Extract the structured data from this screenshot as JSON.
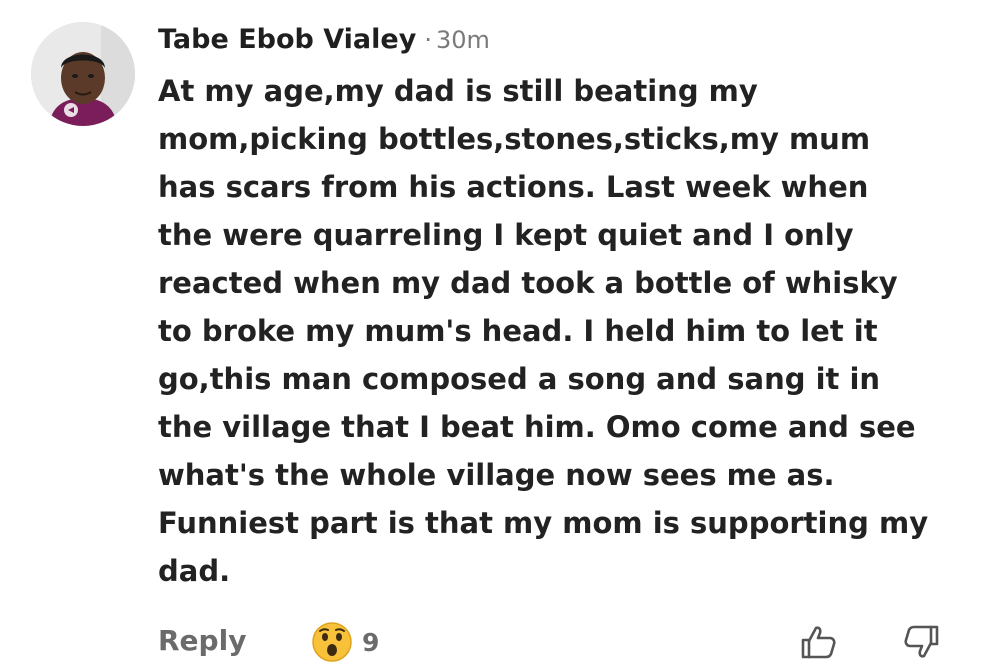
{
  "comment": {
    "author": "Tabe Ebob Vialey",
    "separator": "·",
    "time": "30m",
    "text": "At my age,my dad is still beating my\nmom,picking bottles,stones,sticks,my mum\nhas scars from his actions. Last week when\nthe were quarreling I kept quiet and I only\nreacted when my dad took a bottle of whisky\nto broke my mum's head. I held him to let it\ngo,this man composed a song and sang it in\nthe village that I beat him. Omo come and see\nwhat's the whole village now sees me as.\nFunniest part is that my mom is supporting my\ndad."
  },
  "actions": {
    "reply_label": "Reply",
    "reaction_icon": "surprised-face-emoji",
    "reaction_count": "9",
    "like_icon": "thumbs-up-icon",
    "dislike_icon": "thumbs-down-icon"
  },
  "colors": {
    "text": "#222222",
    "muted": "#6b6b6b",
    "emoji": "#f7c23a"
  }
}
